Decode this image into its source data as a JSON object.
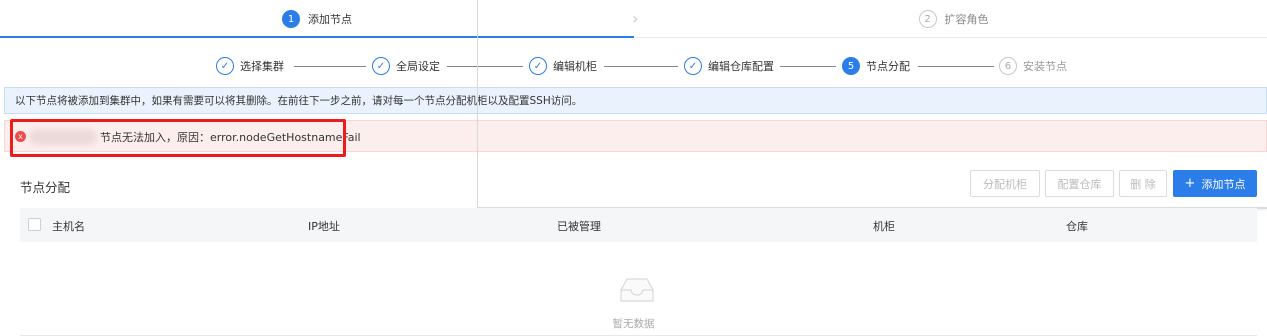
{
  "main_steps": [
    {
      "num": "1",
      "label": "添加节点"
    },
    {
      "num": "2",
      "label": "扩容角色"
    }
  ],
  "sub_steps": [
    {
      "icon": "check-icon",
      "label": "选择集群"
    },
    {
      "icon": "check-icon",
      "label": "全局设定"
    },
    {
      "icon": "check-icon",
      "label": "编辑机柜"
    },
    {
      "icon": "check-icon",
      "label": "编辑仓库配置"
    },
    {
      "num": "5",
      "label": "节点分配"
    },
    {
      "num": "6",
      "label": "安装节点"
    }
  ],
  "info_text": "以下节点将被添加到集群中，如果有需要可以将其删除。在前往下一步之前，请对每一个节点分配机柜以及配置SSH访问。",
  "error": {
    "icon": "x",
    "message": "节点无法加入，原因：error.nodeGetHostnameFail"
  },
  "section_title": "节点分配",
  "toolbar": {
    "assign_rack": "分配机柜",
    "config_repo": "配置仓库",
    "delete": "删 除",
    "add_node_icon": "+",
    "add_node": "添加节点"
  },
  "table": {
    "columns": [
      "主机名",
      "IP地址",
      "已被管理",
      "机柜",
      "仓库"
    ]
  },
  "empty_text": "暂无数据",
  "colors": {
    "primary": "#2b7de9",
    "error": "#f04848",
    "highlight": "#ee1b1b"
  }
}
